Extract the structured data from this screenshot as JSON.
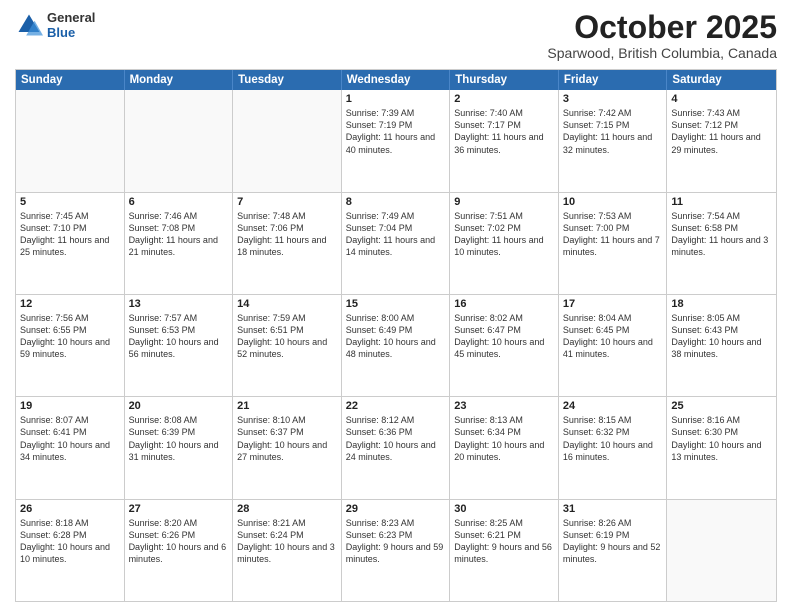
{
  "header": {
    "logo": {
      "general": "General",
      "blue": "Blue"
    },
    "title": "October 2025",
    "location": "Sparwood, British Columbia, Canada"
  },
  "calendar": {
    "days": [
      "Sunday",
      "Monday",
      "Tuesday",
      "Wednesday",
      "Thursday",
      "Friday",
      "Saturday"
    ],
    "rows": [
      [
        {
          "day": "",
          "empty": true
        },
        {
          "day": "",
          "empty": true
        },
        {
          "day": "",
          "empty": true
        },
        {
          "day": "1",
          "sunrise": "7:39 AM",
          "sunset": "7:19 PM",
          "daylight": "11 hours and 40 minutes."
        },
        {
          "day": "2",
          "sunrise": "7:40 AM",
          "sunset": "7:17 PM",
          "daylight": "11 hours and 36 minutes."
        },
        {
          "day": "3",
          "sunrise": "7:42 AM",
          "sunset": "7:15 PM",
          "daylight": "11 hours and 32 minutes."
        },
        {
          "day": "4",
          "sunrise": "7:43 AM",
          "sunset": "7:12 PM",
          "daylight": "11 hours and 29 minutes."
        }
      ],
      [
        {
          "day": "5",
          "sunrise": "7:45 AM",
          "sunset": "7:10 PM",
          "daylight": "11 hours and 25 minutes."
        },
        {
          "day": "6",
          "sunrise": "7:46 AM",
          "sunset": "7:08 PM",
          "daylight": "11 hours and 21 minutes."
        },
        {
          "day": "7",
          "sunrise": "7:48 AM",
          "sunset": "7:06 PM",
          "daylight": "11 hours and 18 minutes."
        },
        {
          "day": "8",
          "sunrise": "7:49 AM",
          "sunset": "7:04 PM",
          "daylight": "11 hours and 14 minutes."
        },
        {
          "day": "9",
          "sunrise": "7:51 AM",
          "sunset": "7:02 PM",
          "daylight": "11 hours and 10 minutes."
        },
        {
          "day": "10",
          "sunrise": "7:53 AM",
          "sunset": "7:00 PM",
          "daylight": "11 hours and 7 minutes."
        },
        {
          "day": "11",
          "sunrise": "7:54 AM",
          "sunset": "6:58 PM",
          "daylight": "11 hours and 3 minutes."
        }
      ],
      [
        {
          "day": "12",
          "sunrise": "7:56 AM",
          "sunset": "6:55 PM",
          "daylight": "10 hours and 59 minutes."
        },
        {
          "day": "13",
          "sunrise": "7:57 AM",
          "sunset": "6:53 PM",
          "daylight": "10 hours and 56 minutes."
        },
        {
          "day": "14",
          "sunrise": "7:59 AM",
          "sunset": "6:51 PM",
          "daylight": "10 hours and 52 minutes."
        },
        {
          "day": "15",
          "sunrise": "8:00 AM",
          "sunset": "6:49 PM",
          "daylight": "10 hours and 48 minutes."
        },
        {
          "day": "16",
          "sunrise": "8:02 AM",
          "sunset": "6:47 PM",
          "daylight": "10 hours and 45 minutes."
        },
        {
          "day": "17",
          "sunrise": "8:04 AM",
          "sunset": "6:45 PM",
          "daylight": "10 hours and 41 minutes."
        },
        {
          "day": "18",
          "sunrise": "8:05 AM",
          "sunset": "6:43 PM",
          "daylight": "10 hours and 38 minutes."
        }
      ],
      [
        {
          "day": "19",
          "sunrise": "8:07 AM",
          "sunset": "6:41 PM",
          "daylight": "10 hours and 34 minutes."
        },
        {
          "day": "20",
          "sunrise": "8:08 AM",
          "sunset": "6:39 PM",
          "daylight": "10 hours and 31 minutes."
        },
        {
          "day": "21",
          "sunrise": "8:10 AM",
          "sunset": "6:37 PM",
          "daylight": "10 hours and 27 minutes."
        },
        {
          "day": "22",
          "sunrise": "8:12 AM",
          "sunset": "6:36 PM",
          "daylight": "10 hours and 24 minutes."
        },
        {
          "day": "23",
          "sunrise": "8:13 AM",
          "sunset": "6:34 PM",
          "daylight": "10 hours and 20 minutes."
        },
        {
          "day": "24",
          "sunrise": "8:15 AM",
          "sunset": "6:32 PM",
          "daylight": "10 hours and 16 minutes."
        },
        {
          "day": "25",
          "sunrise": "8:16 AM",
          "sunset": "6:30 PM",
          "daylight": "10 hours and 13 minutes."
        }
      ],
      [
        {
          "day": "26",
          "sunrise": "8:18 AM",
          "sunset": "6:28 PM",
          "daylight": "10 hours and 10 minutes."
        },
        {
          "day": "27",
          "sunrise": "8:20 AM",
          "sunset": "6:26 PM",
          "daylight": "10 hours and 6 minutes."
        },
        {
          "day": "28",
          "sunrise": "8:21 AM",
          "sunset": "6:24 PM",
          "daylight": "10 hours and 3 minutes."
        },
        {
          "day": "29",
          "sunrise": "8:23 AM",
          "sunset": "6:23 PM",
          "daylight": "9 hours and 59 minutes."
        },
        {
          "day": "30",
          "sunrise": "8:25 AM",
          "sunset": "6:21 PM",
          "daylight": "9 hours and 56 minutes."
        },
        {
          "day": "31",
          "sunrise": "8:26 AM",
          "sunset": "6:19 PM",
          "daylight": "9 hours and 52 minutes."
        },
        {
          "day": "",
          "empty": true
        }
      ]
    ]
  }
}
